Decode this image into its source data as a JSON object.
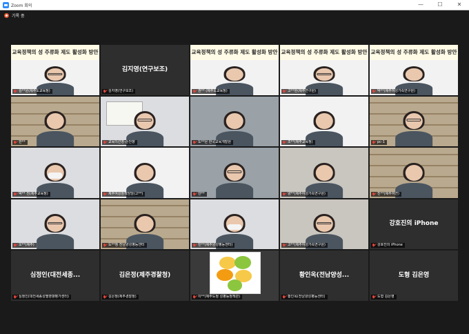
{
  "window": {
    "title": "Zoom 회의",
    "minimize": "—",
    "maximize": "☐",
    "close": "✕"
  },
  "recording": {
    "label": "기록 중"
  },
  "banner_text": "교육정책의 성 주류화 제도 활성화 방안",
  "participants": [
    {
      "label": "김**원(제주도교육청)",
      "big": "",
      "style": "banner-person"
    },
    {
      "label": "김지영(연구보조)",
      "big": "김지영(연구보조)",
      "style": "name"
    },
    {
      "label": "권** (제주도교육청)",
      "big": "",
      "style": "banner-person"
    },
    {
      "label": "고**현(제주연구원)",
      "big": "",
      "style": "banner-person"
    },
    {
      "label": "박**(제주여성가족연구원)",
      "big": "",
      "style": "banner-person"
    },
    {
      "label": "한**",
      "big": "",
      "style": "shelf"
    },
    {
      "label": "교육이선영-순천향",
      "big": "",
      "style": "board"
    },
    {
      "label": "도**은 한국교육개발원",
      "big": "",
      "style": "room"
    },
    {
      "label": "조**(제주교육청)",
      "big": "",
      "style": "white"
    },
    {
      "label": "pc-1",
      "big": "",
      "style": "shelf"
    },
    {
      "label": "박** 전(제주교육청)",
      "big": "",
      "style": "light-mask"
    },
    {
      "label": "제주여성정책담당(고**)",
      "big": "",
      "style": "white"
    },
    {
      "label": "안**",
      "big": "",
      "style": "room"
    },
    {
      "label": "양**(제주여성가족연구원)",
      "big": "",
      "style": "office"
    },
    {
      "label": "진**(제주여연)",
      "big": "",
      "style": "shelf"
    },
    {
      "label": "오**(제주)",
      "big": "",
      "style": "light"
    },
    {
      "label": "도**정 전남양성평등센터",
      "big": "",
      "style": "shelf"
    },
    {
      "label": "민**(제주양성평등센터)",
      "big": "",
      "style": "light-mask"
    },
    {
      "label": "고**(제주여성가족연구원)",
      "big": "",
      "style": "office"
    },
    {
      "label": "강호진의 iPhone",
      "big": "강호진의 iPhone",
      "style": "name"
    },
    {
      "label": "심정인(대전세종성별영향평가센터)",
      "big": "심정인(대전세종...",
      "style": "name"
    },
    {
      "label": "김은정(제주경찰청)",
      "big": "김은정(제주경찰청)",
      "style": "name"
    },
    {
      "label": "이**(제주도청 성평등정책관)",
      "big": "",
      "style": "logo"
    },
    {
      "label": "황인옥(전남양성평등센터)",
      "big": "황인옥(전남양성...",
      "style": "name"
    },
    {
      "label": "도형 김은영",
      "big": "도형 김은영",
      "style": "name"
    }
  ]
}
